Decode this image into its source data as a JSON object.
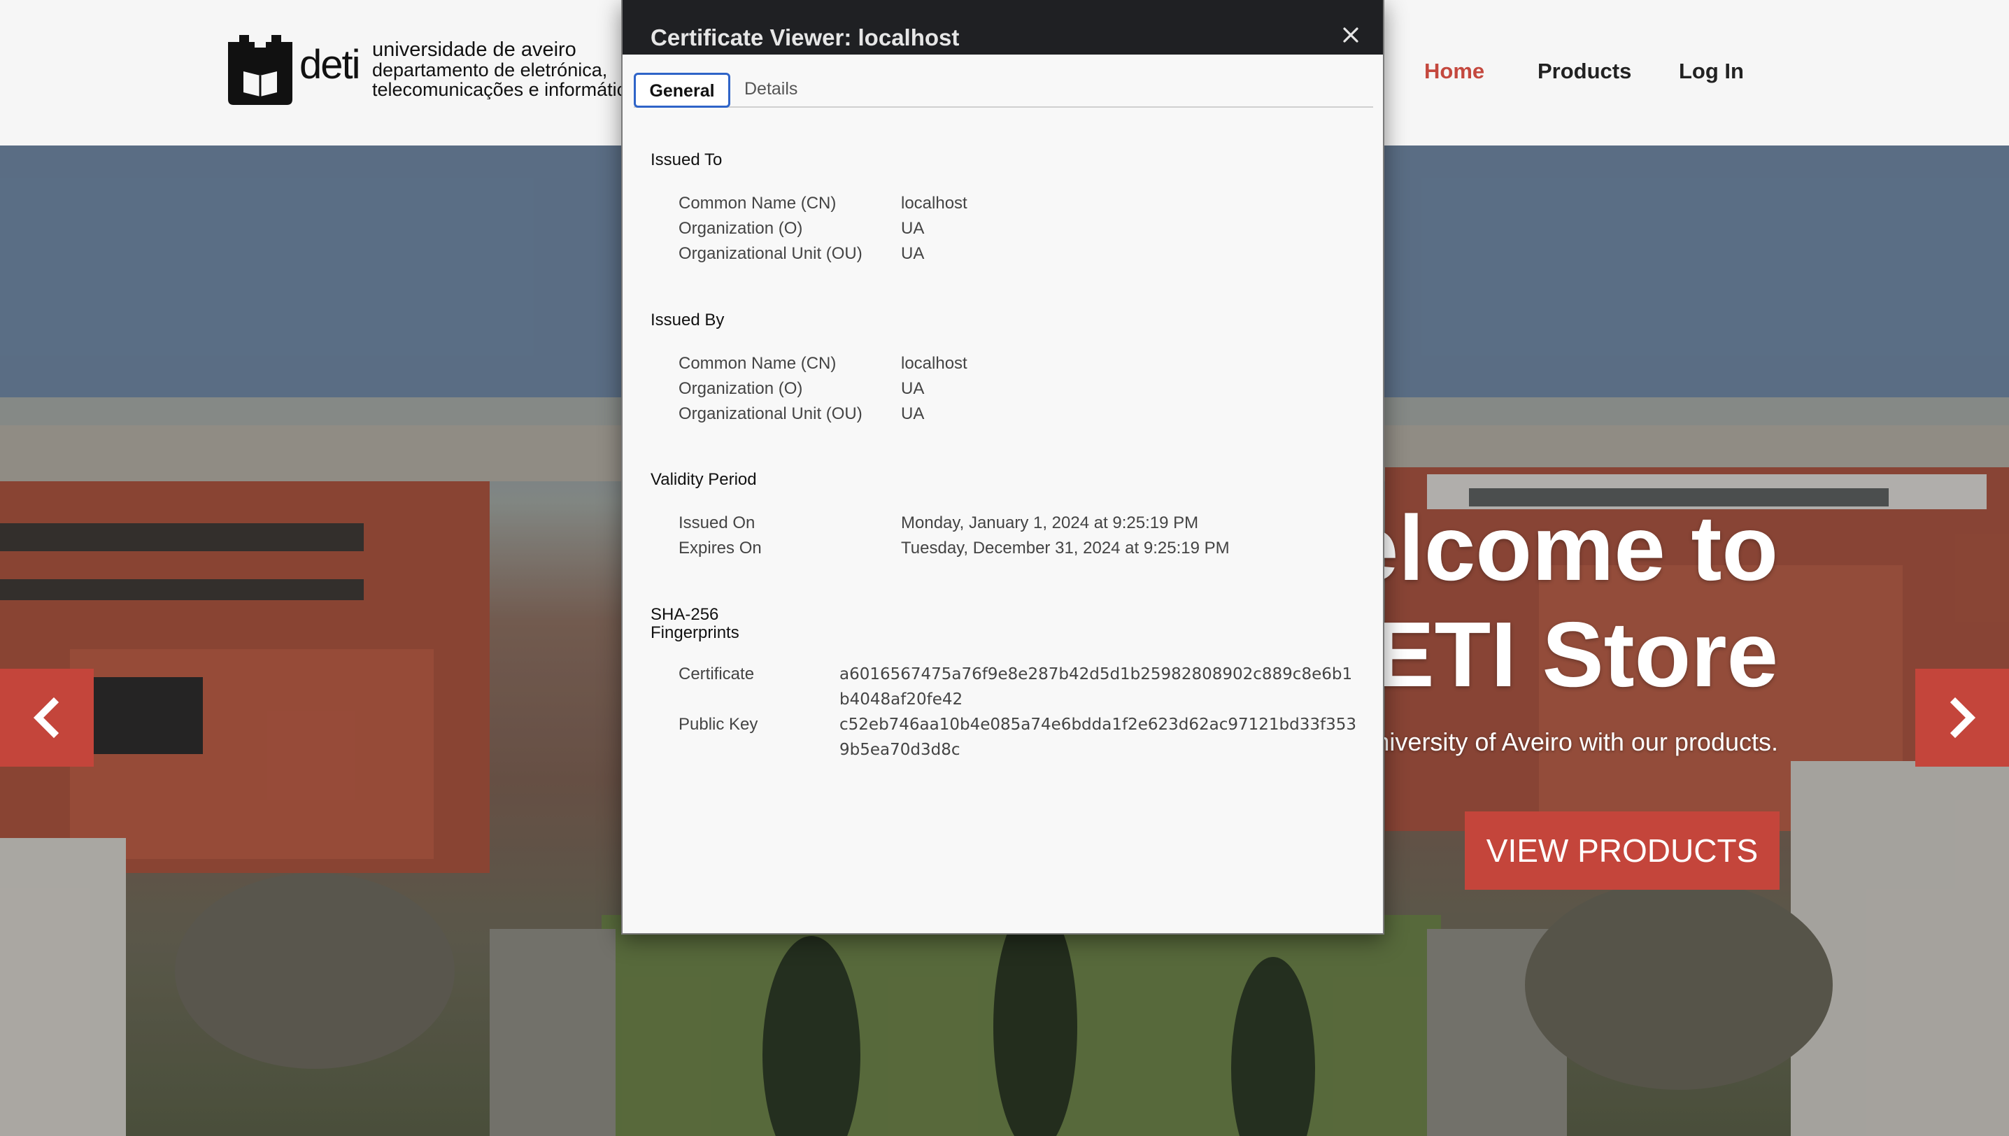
{
  "header": {
    "logo": {
      "mark_icon": "deti-castle-logo",
      "wordmark": "deti",
      "line1": "universidade de aveiro",
      "line2": "departamento de eletrónica,",
      "line3": "telecomunicações e informática"
    },
    "nav": [
      {
        "label": "Home",
        "active": true
      },
      {
        "label": "Products",
        "active": false
      },
      {
        "label": "Log In",
        "active": false
      }
    ],
    "accent_color": "#c4483e"
  },
  "hero": {
    "title_line1": "Welcome to",
    "title_line2": "DETI Store",
    "subtitle": "Support the University of Aveiro with our products.",
    "cta_label": "VIEW PRODUCTS",
    "prev_icon": "chevron-left-icon",
    "next_icon": "chevron-right-icon"
  },
  "dialog": {
    "title": "Certificate Viewer: localhost",
    "close_icon": "close-icon",
    "tabs": [
      {
        "label": "General",
        "selected": true
      },
      {
        "label": "Details",
        "selected": false
      }
    ],
    "issued_to": {
      "heading": "Issued To",
      "fields": [
        {
          "label": "Common Name (CN)",
          "value": "localhost"
        },
        {
          "label": "Organization (O)",
          "value": "UA"
        },
        {
          "label": "Organizational Unit (OU)",
          "value": "UA"
        }
      ]
    },
    "issued_by": {
      "heading": "Issued By",
      "fields": [
        {
          "label": "Common Name (CN)",
          "value": "localhost"
        },
        {
          "label": "Organization (O)",
          "value": "UA"
        },
        {
          "label": "Organizational Unit (OU)",
          "value": "UA"
        }
      ]
    },
    "validity": {
      "heading": "Validity Period",
      "fields": [
        {
          "label": "Issued On",
          "value": "Monday, January 1, 2024 at 9:25:19 PM"
        },
        {
          "label": "Expires On",
          "value": "Tuesday, December 31, 2024 at 9:25:19 PM"
        }
      ]
    },
    "fingerprints": {
      "heading_line1": "SHA-256",
      "heading_line2": "Fingerprints",
      "fields": [
        {
          "label": "Certificate",
          "value": "a6016567475a76f9e8e287b42d5d1b25982808902c889c8e6b1b4048af20fe42"
        },
        {
          "label": "Public Key",
          "value": "c52eb746aa10b4e085a74e6bdda1f2e623d62ac97121bd33f3539b5ea70d3d8c"
        }
      ]
    }
  }
}
